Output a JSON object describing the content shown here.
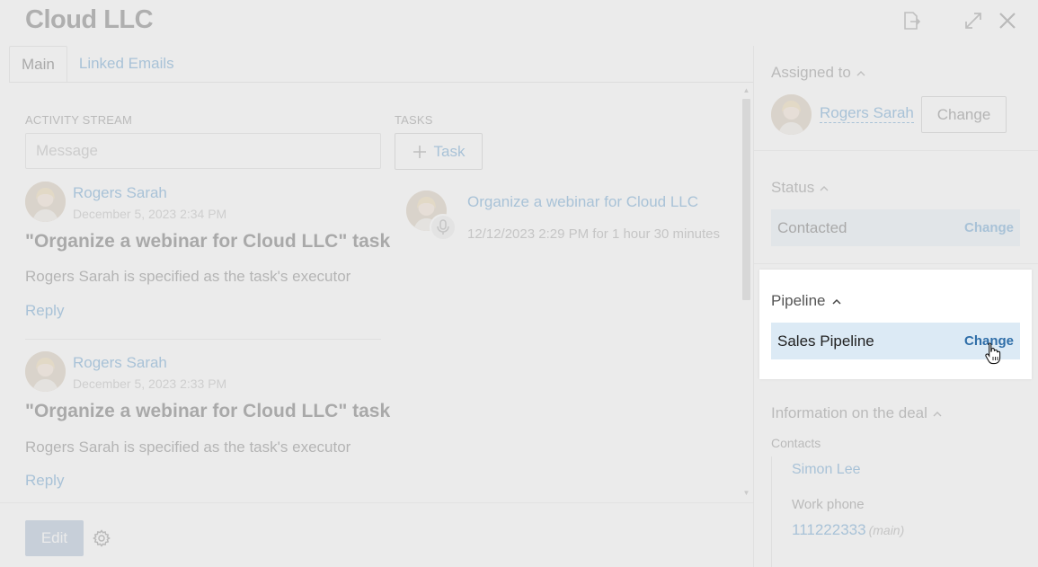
{
  "window": {
    "title": "Cloud LLC"
  },
  "tabs": [
    {
      "label": "Main"
    },
    {
      "label": "Linked Emails"
    }
  ],
  "activity": {
    "section_label": "ACTIVITY STREAM",
    "message_placeholder": "Message",
    "items": [
      {
        "author": "Rogers Sarah",
        "timestamp": "December 5, 2023 2:34 PM",
        "title": "\"Organize a webinar for Cloud LLC\" task",
        "body": "Rogers Sarah is specified as the task's executor",
        "reply_label": "Reply"
      },
      {
        "author": "Rogers Sarah",
        "timestamp": "December 5, 2023 2:33 PM",
        "title": "\"Organize a webinar for Cloud LLC\" task",
        "body": "Rogers Sarah is specified as the task's executor",
        "reply_label": "Reply"
      }
    ]
  },
  "tasks": {
    "section_label": "TASKS",
    "add_label": "Task",
    "items": [
      {
        "title": "Organize a webinar for Cloud LLC",
        "meta": "12/12/2023 2:29 PM for 1 hour 30 minutes"
      }
    ]
  },
  "footer": {
    "edit_label": "Edit"
  },
  "sidebar": {
    "assigned": {
      "title": "Assigned to",
      "name": "Rogers Sarah",
      "change_label": "Change"
    },
    "status": {
      "title": "Status",
      "value": "Contacted",
      "change_label": "Change"
    },
    "pipeline": {
      "title": "Pipeline",
      "value": "Sales Pipeline",
      "change_label": "Change"
    },
    "info": {
      "title": "Information on the deal",
      "contacts_label": "Contacts",
      "contact_name": "Simon Lee",
      "phone_label": "Work phone",
      "phone_value": "111222333",
      "phone_tag": "(main)"
    }
  },
  "colors": {
    "accent": "#2f7fc1",
    "highlight_field": "#dceaf5",
    "edit_button": "#8fa9c7"
  }
}
